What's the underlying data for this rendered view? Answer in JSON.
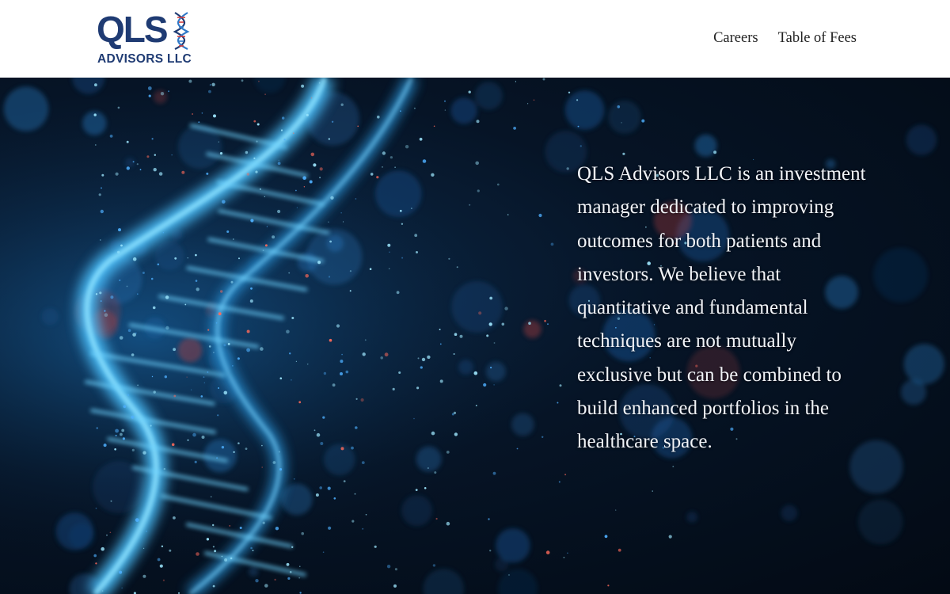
{
  "header": {
    "logo": {
      "mark_text": "QLS",
      "sub_text": "ADVISORS LLC",
      "brand_color": "#1f3b73",
      "helix_icon": "dna-helix-icon"
    },
    "nav": [
      {
        "label": "Careers"
      },
      {
        "label": "Table of Fees"
      }
    ]
  },
  "hero": {
    "background_image": "dna-particle-helix",
    "description": "QLS Advisors LLC is an investment manager dedicated to improving outcomes for both patients and investors. We believe that quantitative and fundamental techniques are not mutually exclusive but can be combined to build enhanced portfolios in the healthcare space."
  },
  "colors": {
    "text_light": "#f2f4f8",
    "nav_text": "#222222",
    "hero_dark": "#030a14",
    "helix_glow": "#5ad2ff"
  }
}
